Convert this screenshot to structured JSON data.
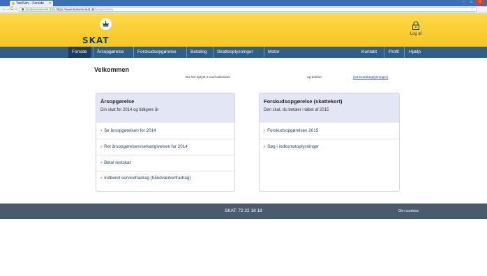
{
  "browser": {
    "tab_title": "TastSelv - Forside",
    "tab_close": "×",
    "secure_label": "Skatteministeriet [DK]",
    "url_host": "https://www.tastselv.skat.dk",
    "url_path": "/borger/menu",
    "back_glyph": "←",
    "forward_glyph": "→",
    "reload_glyph": "C",
    "home_glyph": "⌂",
    "star_glyph": "☆",
    "minimize_glyph": "–",
    "maximize_glyph": "□",
    "close_glyph": "×"
  },
  "header": {
    "brand": "SKAT",
    "logout_label": "Log af",
    "crown_icon": "crown-icon",
    "logout_icon": "padlock-icon"
  },
  "nav": {
    "items": [
      {
        "label": "Forside"
      },
      {
        "label": "Årsopgørelse"
      },
      {
        "label": "Forskudsopgørelse"
      },
      {
        "label": "Betaling"
      },
      {
        "label": "Skatteoplysninger"
      },
      {
        "label": "Motor"
      },
      {
        "label": "Kontakt"
      },
      {
        "label": "Profil"
      },
      {
        "label": "Hjælp"
      }
    ]
  },
  "main": {
    "welcome": "Velkommen",
    "email_note": "Du har oplyst e-mail-adressen",
    "phone_note": "og telefon",
    "contact_link": "(ret kontaktoplysninger)"
  },
  "cards": [
    {
      "title": "Årsopgørelse",
      "subtitle": "Din skat for 2014 og tidligere år",
      "links": [
        "Se årsopgørelsen for 2014",
        "Ret årsopgørelsen/selvangivelsen for 2014",
        "Betal restskat",
        "Indberet servicefradrag (håndværkerfradrag)"
      ]
    },
    {
      "title": "Forskudsopgørelse (skattekort)",
      "subtitle": "Den skat, du betaler i løbet af 2015",
      "links": [
        "Forskudsopgørelsen 2015",
        "Søg i indkomstoplysninger"
      ]
    }
  ],
  "footer": {
    "phone": "SKAT: 72 22 18 18",
    "cookies": "Om cookies"
  },
  "colors": {
    "header_yellow": "#f5c623",
    "nav_blue": "#2f5f89",
    "nav_active": "#1d3e5e",
    "card_head": "#e3e6f4",
    "footer": "#4a5c6c"
  }
}
